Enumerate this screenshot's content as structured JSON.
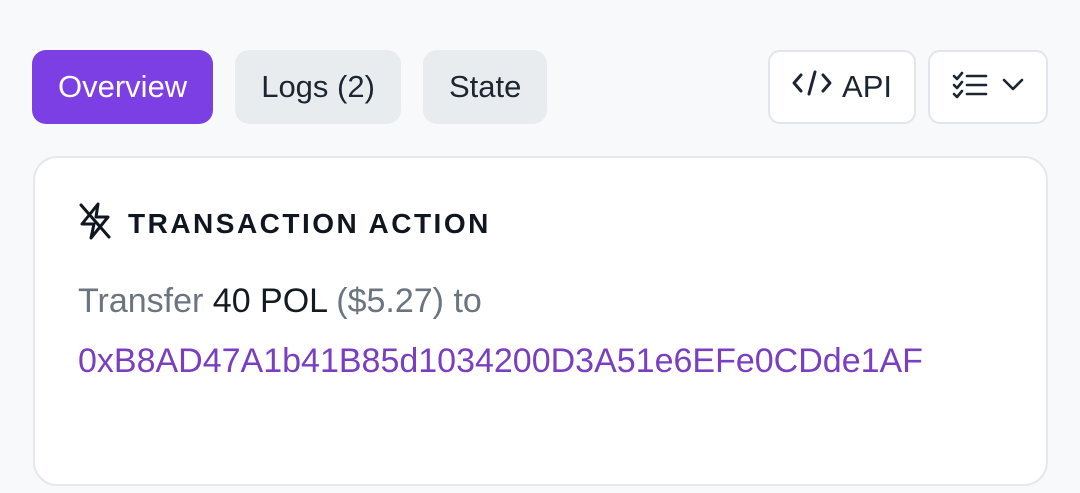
{
  "tabs": [
    {
      "label": "Overview",
      "active": true
    },
    {
      "label": "Logs (2)",
      "active": false
    },
    {
      "label": "State",
      "active": false
    }
  ],
  "toolbar": {
    "api_label": "API",
    "api_icon": "code-icon",
    "menu_icon": "checklist-icon",
    "menu_chevron": "chevron-down-icon"
  },
  "card": {
    "icon": "lightning-bolt-icon",
    "title": "TRANSACTION ACTION",
    "action_verb": "Transfer",
    "amount": "40 POL",
    "usd_value": "($5.27)",
    "connector": "to",
    "address": "0xB8AD47A1b41B85d1034200D3A51e6EFe0CDde1AF"
  },
  "colors": {
    "accent": "#7b3fe4",
    "address": "#7a3fc0",
    "muted_text": "#6b7580",
    "tab_inactive_bg": "#e9ecef"
  }
}
